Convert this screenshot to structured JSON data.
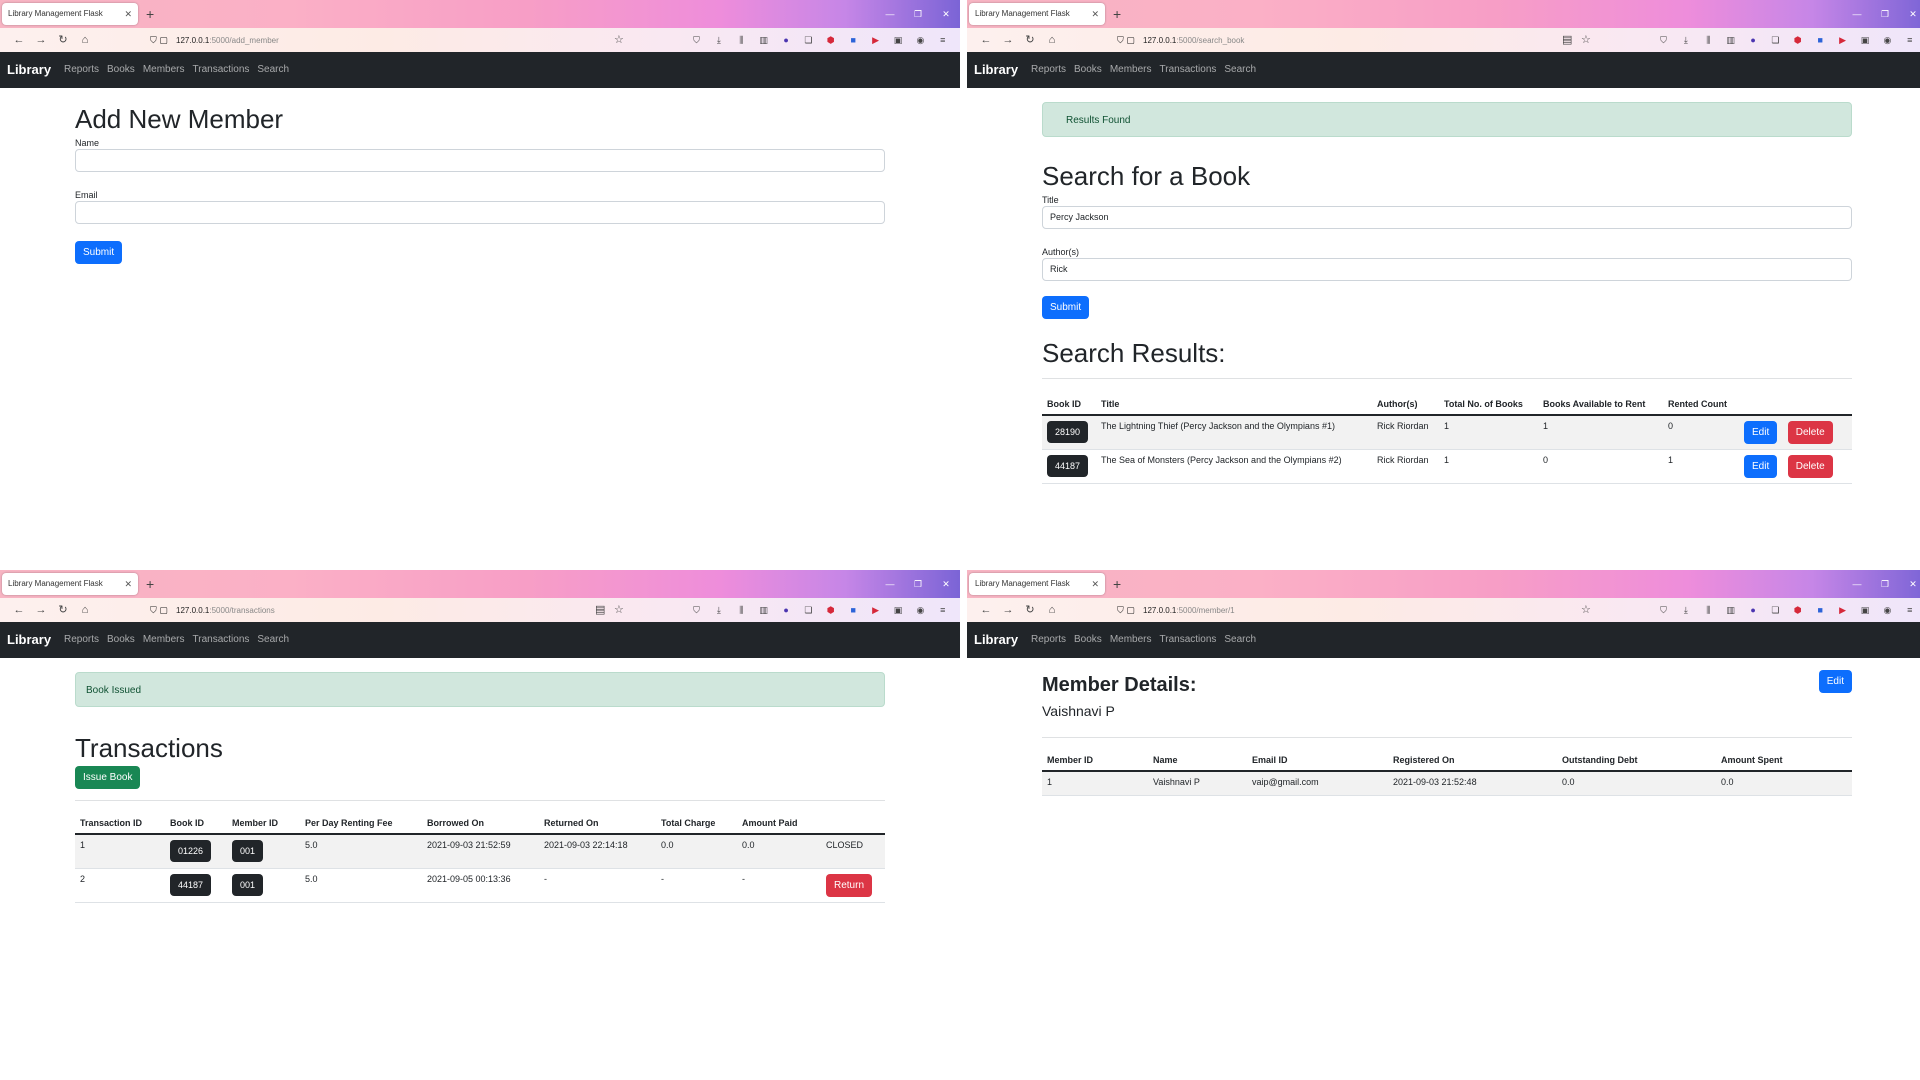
{
  "browser": {
    "tab_title": "Library Management Flask",
    "url_host": "127.0.0.1",
    "brand": "Library",
    "nav": [
      "Reports",
      "Books",
      "Members",
      "Transactions",
      "Search"
    ]
  },
  "add_member": {
    "url_path": ":5000/add_member",
    "title": "Add New Member",
    "name_label": "Name",
    "name_value": "",
    "email_label": "Email",
    "email_value": "",
    "submit": "Submit"
  },
  "search_book": {
    "url_path": ":5000/search_book",
    "alert": "Results Found",
    "title": "Search for a Book",
    "title_label": "Title",
    "title_value": "Percy Jackson",
    "author_label": "Author(s)",
    "author_value": "Rick",
    "submit": "Submit",
    "results_title": "Search Results:",
    "columns": [
      "Book ID",
      "Title",
      "Author(s)",
      "Total No. of Books",
      "Books Available to Rent",
      "Rented Count"
    ],
    "rows": [
      {
        "id": "28190",
        "title": "The Lightning Thief (Percy Jackson and the Olympians #1)",
        "author": "Rick Riordan",
        "total": "1",
        "available": "1",
        "rented": "0"
      },
      {
        "id": "44187",
        "title": "The Sea of Monsters (Percy Jackson and the Olympians #2)",
        "author": "Rick Riordan",
        "total": "1",
        "available": "0",
        "rented": "1"
      }
    ],
    "edit": "Edit",
    "delete": "Delete"
  },
  "transactions": {
    "url_path": ":5000/transactions",
    "alert": "Book Issued",
    "title": "Transactions",
    "issue_button": "Issue Book",
    "columns": [
      "Transaction ID",
      "Book ID",
      "Member ID",
      "Per Day Renting Fee",
      "Borrowed On",
      "Returned On",
      "Total Charge",
      "Amount Paid"
    ],
    "rows": [
      {
        "id": "1",
        "book": "01226",
        "member": "001",
        "fee": "5.0",
        "borrowed": "2021-09-03 21:52:59",
        "returned": "2021-09-03 22:14:18",
        "charge": "0.0",
        "paid": "0.0",
        "status": "CLOSED"
      },
      {
        "id": "2",
        "book": "44187",
        "member": "001",
        "fee": "5.0",
        "borrowed": "2021-09-05 00:13:36",
        "returned": "-",
        "charge": "-",
        "paid": "-",
        "status": "Return"
      }
    ]
  },
  "member": {
    "url_path": ":5000/member/1",
    "heading": "Member Details:",
    "name": "Vaishnavi P",
    "edit": "Edit",
    "columns": [
      "Member ID",
      "Name",
      "Email ID",
      "Registered On",
      "Outstanding Debt",
      "Amount Spent"
    ],
    "row": {
      "id": "1",
      "name": "Vaishnavi P",
      "email": "vaip@gmail.com",
      "registered": "2021-09-03 21:52:48",
      "debt": "0.0",
      "spent": "0.0"
    }
  },
  "icons": {
    "nav": [
      "back-arrow-icon",
      "forward-arrow-icon",
      "reload-icon",
      "home-icon"
    ],
    "extensions": [
      "pocket-icon",
      "download-icon",
      "library-icon",
      "sidebar-icon",
      "vpn-icon",
      "screenshot-icon",
      "adblock-icon",
      "extension-icon",
      "youtube-icon",
      "container-icon",
      "profile-icon",
      "menu-icon"
    ]
  }
}
